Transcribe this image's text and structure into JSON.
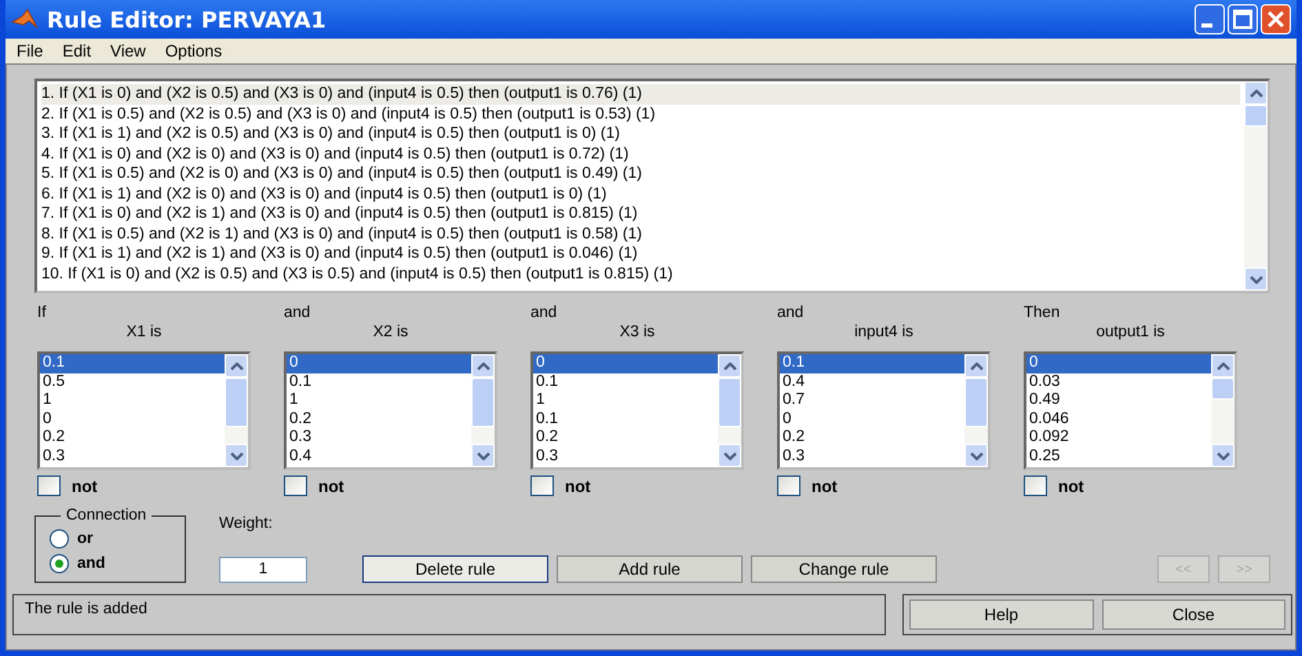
{
  "window": {
    "title": "Rule Editor: PERVAYA1"
  },
  "menu": [
    "File",
    "Edit",
    "View",
    "Options"
  ],
  "rules": [
    {
      "text": "1. If (X1 is 0) and (X2 is 0.5) and (X3 is 0) and (input4 is 0.5) then (output1 is 0.76) (1)",
      "selected": true
    },
    {
      "text": "2. If (X1 is 0.5) and (X2 is 0.5) and (X3 is 0) and (input4 is 0.5) then (output1 is 0.53) (1)",
      "selected": false
    },
    {
      "text": "3. If (X1 is 1) and (X2 is 0.5) and (X3 is 0) and (input4 is 0.5) then (output1 is 0) (1)",
      "selected": false
    },
    {
      "text": "4. If (X1 is 0) and (X2 is 0) and (X3 is 0) and (input4 is 0.5) then (output1 is 0.72) (1)",
      "selected": false
    },
    {
      "text": "5. If (X1 is 0.5) and (X2 is 0) and (X3 is 0) and (input4 is 0.5) then (output1 is 0.49) (1)",
      "selected": false
    },
    {
      "text": "6. If (X1 is 1) and (X2 is 0) and (X3 is 0) and (input4 is 0.5) then (output1 is 0) (1)",
      "selected": false
    },
    {
      "text": "7. If (X1 is 0) and (X2 is 1) and (X3 is 0) and (input4 is 0.5) then (output1 is 0.815) (1)",
      "selected": false
    },
    {
      "text": "8. If (X1 is 0.5) and (X2 is 1) and (X3 is 0) and (input4 is 0.5) then (output1 is 0.58) (1)",
      "selected": false
    },
    {
      "text": "9. If (X1 is 1) and (X2 is 1) and (X3 is 0) and (input4 is 0.5) then (output1 is 0.046) (1)",
      "selected": false
    },
    {
      "text": "10. If (X1 is 0) and (X2 is 0.5) and (X3 is 0.5) and (input4 is 0.5) then (output1 is 0.815) (1)",
      "selected": false
    }
  ],
  "variables": [
    {
      "connector": "If",
      "label": "X1 is",
      "not": false,
      "not_text": "not",
      "items": [
        {
          "label": "0.1",
          "selected": true
        },
        {
          "label": "0.5",
          "selected": false
        },
        {
          "label": "1",
          "selected": false
        },
        {
          "label": "0",
          "selected": false
        },
        {
          "label": "0.2",
          "selected": false
        },
        {
          "label": "0.3",
          "selected": false
        }
      ]
    },
    {
      "connector": "and",
      "label": "X2 is",
      "not": false,
      "not_text": "not",
      "items": [
        {
          "label": "0",
          "selected": true
        },
        {
          "label": "0.1",
          "selected": false
        },
        {
          "label": "1",
          "selected": false
        },
        {
          "label": "0.2",
          "selected": false
        },
        {
          "label": "0.3",
          "selected": false
        },
        {
          "label": "0.4",
          "selected": false
        }
      ]
    },
    {
      "connector": "and",
      "label": "X3 is",
      "not": false,
      "not_text": "not",
      "items": [
        {
          "label": "0",
          "selected": true
        },
        {
          "label": "0.1",
          "selected": false
        },
        {
          "label": "1",
          "selected": false
        },
        {
          "label": "0.1",
          "selected": false
        },
        {
          "label": "0.2",
          "selected": false
        },
        {
          "label": "0.3",
          "selected": false
        }
      ]
    },
    {
      "connector": "and",
      "label": "input4 is",
      "not": false,
      "not_text": "not",
      "items": [
        {
          "label": "0.1",
          "selected": true
        },
        {
          "label": "0.4",
          "selected": false
        },
        {
          "label": "0.7",
          "selected": false
        },
        {
          "label": "0",
          "selected": false
        },
        {
          "label": "0.2",
          "selected": false
        },
        {
          "label": "0.3",
          "selected": false
        }
      ]
    },
    {
      "connector": "Then",
      "label": "output1 is",
      "not": false,
      "not_text": "not",
      "items": [
        {
          "label": "0",
          "selected": true
        },
        {
          "label": "0.03",
          "selected": false
        },
        {
          "label": "0.49",
          "selected": false
        },
        {
          "label": "0.046",
          "selected": false
        },
        {
          "label": "0.092",
          "selected": false
        },
        {
          "label": "0.25",
          "selected": false
        }
      ]
    }
  ],
  "connection": {
    "title": "Connection",
    "options": [
      {
        "label": "or",
        "selected": false
      },
      {
        "label": "and",
        "selected": true
      }
    ]
  },
  "weight": {
    "label": "Weight:",
    "value": "1"
  },
  "buttons": [
    {
      "label": "Delete rule",
      "disabled": false
    },
    {
      "label": "Add rule",
      "disabled": false
    },
    {
      "label": "Change rule",
      "disabled": false
    }
  ],
  "nav_buttons": [
    {
      "label": "<<",
      "disabled": true
    },
    {
      "label": ">>",
      "disabled": true
    }
  ],
  "status": "The rule is added",
  "footer_buttons": [
    "Help",
    "Close"
  ]
}
